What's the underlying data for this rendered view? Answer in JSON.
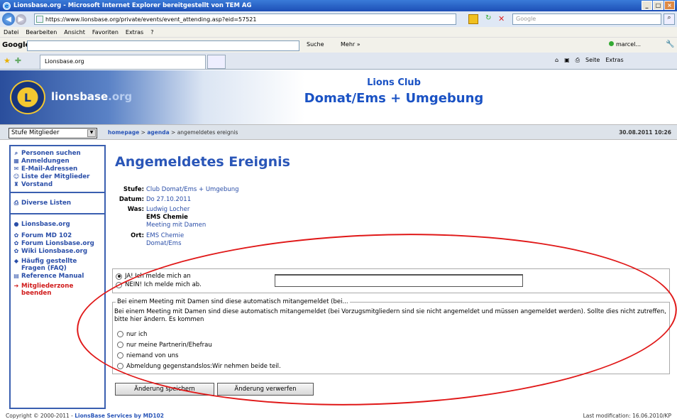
{
  "window": {
    "title": "Lionsbase.org - Microsoft Internet Explorer bereitgestellt von TEM AG",
    "controls": [
      "_",
      "□",
      "×"
    ]
  },
  "address": {
    "url": "https://www.lionsbase.org/private/events/event_attending.asp?eid=57521",
    "search_placeholder": "Google"
  },
  "menu": [
    "Datei",
    "Bearbeiten",
    "Ansicht",
    "Favoriten",
    "Extras",
    "?"
  ],
  "google_toolbar": {
    "logo": "Google",
    "search_label": "Suche",
    "more_label": "Mehr »",
    "user": "marcel..."
  },
  "tabs": {
    "active": "Lionsbase.org"
  },
  "browser_tools": [
    "Seite",
    "Extras"
  ],
  "site": {
    "name_main": "lionsbase",
    "name_suffix": ".org",
    "club_line1": "Lions Club",
    "club_line2": "Domat/Ems + Umgebung"
  },
  "crumbbar": {
    "level_select": "Stufe Mitglieder",
    "crumbs": [
      "homepage",
      "agenda",
      "angemeldetes ereignis"
    ],
    "datetime": "30.08.2011 10:26"
  },
  "sidebar": {
    "group1": [
      "Personen suchen",
      "Anmeldungen",
      "E-Mail-Adressen",
      "Liste der Mitglieder",
      "Vorstand"
    ],
    "group2": [
      "Diverse Listen"
    ],
    "group3": [
      "Lionsbase.org",
      "Forum MD 102",
      "Forum Lionsbase.org",
      "Wiki Lionsbase.org",
      "Häufig gestellte Fragen (FAQ)",
      "Reference Manual",
      "Mitgliederzone beenden"
    ]
  },
  "event": {
    "heading": "Angemeldetes Ereignis",
    "stufe_label": "Stufe:",
    "stufe": "Club Domat/Ems + Umgebung",
    "datum_label": "Datum:",
    "datum": "Do 27.10.2011",
    "was_label": "Was:",
    "was_line1": "Ludwig Locher",
    "was_line2": "EMS Chemie",
    "was_line3": "Meeting mit Damen",
    "ort_label": "Ort:",
    "ort_line1": "EMS Chemie",
    "ort_line2": "Domat/Ems"
  },
  "attendance": {
    "yes": "JA! Ich melde mich an",
    "no": "NEIN! Ich melde mich ab.",
    "comment_value": ""
  },
  "partner": {
    "legend": "Bei einem Meeting mit Damen sind diese automatisch mitangemeldet (bei...",
    "text": "Bei einem Meeting mit Damen sind diese automatisch mitangemeldet (bei Vorzugsmitgliedern sind sie nicht angemeldet und müssen angemeldet werden). Sollte dies nicht zutreffen, bitte hier ändern. Es kommen",
    "options": [
      "nur ich",
      "nur meine Partnerin/Ehefrau",
      "niemand von uns",
      "Abmeldung gegenstandslos:Wir nehmen beide teil."
    ]
  },
  "buttons": {
    "save": "Änderung speichern",
    "discard": "Änderung verwerfen"
  },
  "footer": {
    "left_prefix": "Copyright © 2000-2011 - ",
    "left_link": "LionsBase Services by MD102",
    "right": "Last modification: 16.06.2010/KP"
  },
  "colors": {
    "link_blue": "#2a56b8",
    "annotation_red": "#e01818",
    "exit_red": "#d01a1a"
  }
}
